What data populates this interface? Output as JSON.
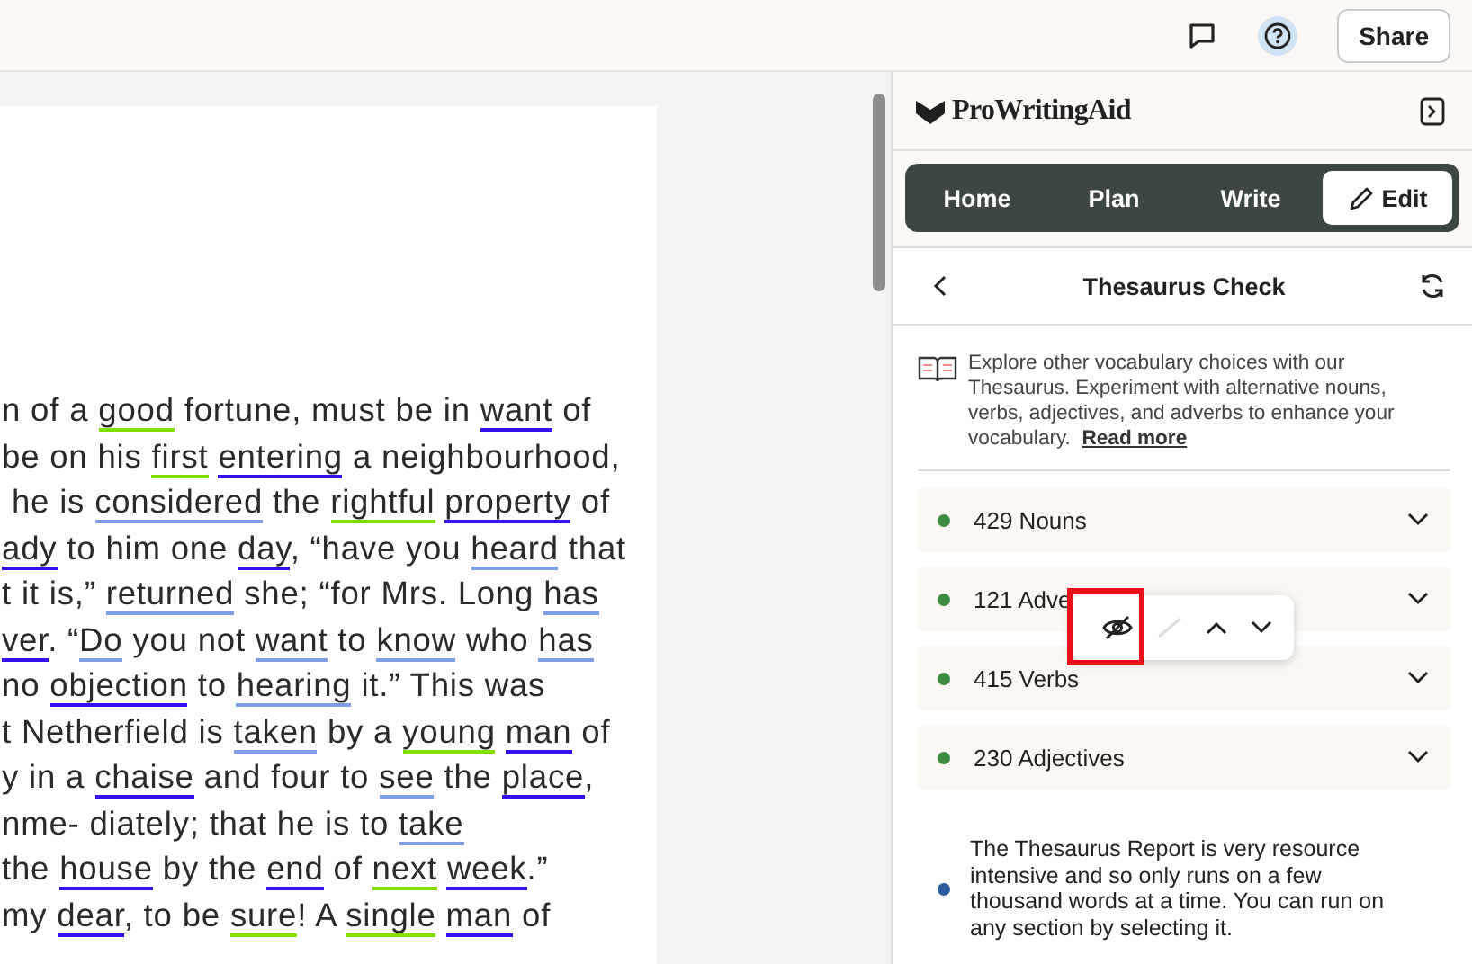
{
  "topbar": {
    "share": "Share"
  },
  "document": {
    "lines": [
      [
        {
          "t": "n of a "
        },
        {
          "t": "good",
          "color": "#84e000"
        },
        {
          "t": " fortune, must be in "
        },
        {
          "t": "want",
          "color": "#3311ee"
        },
        {
          "t": " of"
        }
      ],
      [
        {
          "t": "be on his "
        },
        {
          "t": "first ",
          "color": "#84e000"
        },
        {
          "t": "entering",
          "color": "#3311ee"
        },
        {
          "t": " a neighbourhood,"
        }
      ],
      [
        {
          "t": " he is "
        },
        {
          "t": "considered",
          "color": "#7fa0e8"
        },
        {
          "t": " the "
        },
        {
          "t": "rightful ",
          "color": "#84e000"
        },
        {
          "t": "property",
          "color": "#3311ee"
        },
        {
          "t": " of"
        }
      ],
      [
        {
          "t": "ady",
          "color": "#3311ee"
        },
        {
          "t": " to him one "
        },
        {
          "t": "day",
          "color": "#3311ee"
        },
        {
          "t": ", “have you "
        },
        {
          "t": "heard",
          "color": "#7fa0e8"
        },
        {
          "t": " that"
        }
      ],
      [
        {
          "t": "t it is,” "
        },
        {
          "t": "returned",
          "color": "#7fa0e8"
        },
        {
          "t": " she; “for Mrs. Long "
        },
        {
          "t": "has",
          "color": "#7fa0e8"
        }
      ],
      [
        {
          "t": "ver",
          "color": "#3311ee"
        },
        {
          "t": ". “"
        },
        {
          "t": "Do",
          "color": "#7fa0e8"
        },
        {
          "t": " you not "
        },
        {
          "t": "want",
          "color": "#7fa0e8"
        },
        {
          "t": " to "
        },
        {
          "t": "know",
          "color": "#7fa0e8"
        },
        {
          "t": " who "
        },
        {
          "t": "has",
          "color": "#7fa0e8"
        }
      ],
      [
        {
          "t": "no "
        },
        {
          "t": "objection",
          "color": "#3311ee"
        },
        {
          "t": " to "
        },
        {
          "t": "hearing",
          "color": "#7fa0e8"
        },
        {
          "t": " it.” This was"
        }
      ],
      [
        {
          "t": "t Netherfield is "
        },
        {
          "t": "taken",
          "color": "#7fa0e8"
        },
        {
          "t": " by a "
        },
        {
          "t": "young ",
          "color": "#84e000"
        },
        {
          "t": "man",
          "color": "#3311ee"
        },
        {
          "t": " of"
        }
      ],
      [
        {
          "t": "y in a "
        },
        {
          "t": "chaise",
          "color": "#3311ee"
        },
        {
          "t": " and four to "
        },
        {
          "t": "see",
          "color": "#7fa0e8"
        },
        {
          "t": " the "
        },
        {
          "t": "place",
          "color": "#3311ee"
        },
        {
          "t": ","
        }
      ],
      [
        {
          "t": "nme- diately; that he is to "
        },
        {
          "t": "take",
          "color": "#7fa0e8"
        }
      ],
      [
        {
          "t": "the "
        },
        {
          "t": "house",
          "color": "#3311ee"
        },
        {
          "t": " by the "
        },
        {
          "t": "end",
          "color": "#3311ee"
        },
        {
          "t": " of "
        },
        {
          "t": "next ",
          "color": "#84e000"
        },
        {
          "t": "week",
          "color": "#3311ee"
        },
        {
          "t": ".”"
        }
      ],
      [
        {
          "t": "my "
        },
        {
          "t": "dear",
          "color": "#3311ee"
        },
        {
          "t": ", to be "
        },
        {
          "t": "sure",
          "color": "#84e000"
        },
        {
          "t": "! A "
        },
        {
          "t": "single ",
          "color": "#84e000"
        },
        {
          "t": "man",
          "color": "#3311ee"
        },
        {
          "t": " of"
        }
      ]
    ]
  },
  "panel": {
    "logo": "ProWritingAid",
    "tabs": [
      {
        "label": "Home",
        "selected": false
      },
      {
        "label": "Plan",
        "selected": false
      },
      {
        "label": "Write",
        "selected": false
      },
      {
        "label": "Edit",
        "selected": true
      }
    ],
    "title": "Thesaurus Check",
    "intro": "Explore other vocabulary choices with our Thesaurus. Experiment with alternative nouns, verbs, adjectives, and adverbs to enhance your vocabulary.",
    "read_more": "Read more",
    "categories": [
      {
        "label": "429 Nouns",
        "color": "#3e8e41"
      },
      {
        "label": "121 Adve",
        "color": "#3e8e41"
      },
      {
        "label": "415 Verbs",
        "color": "#3e8e41"
      },
      {
        "label": "230 Adjectives",
        "color": "#3e8e41"
      }
    ],
    "note": {
      "text": "The Thesaurus Report is very resource intensive and so only runs on a few thousand words at a time. You can run on any section by selecting it.",
      "color": "#2b5c9e"
    }
  }
}
